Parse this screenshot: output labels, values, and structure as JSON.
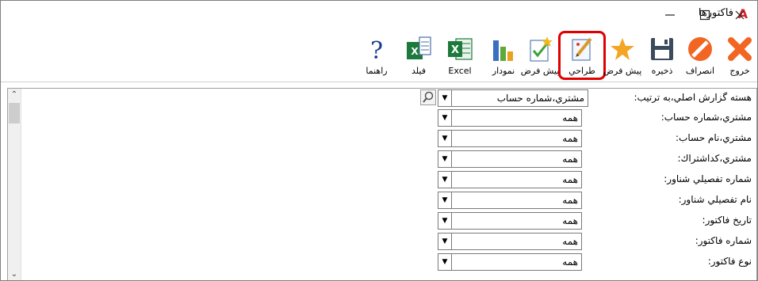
{
  "window": {
    "title": "فاکتورها"
  },
  "toolbar": {
    "help": "راهنما",
    "field": "فیلد",
    "excel": "Excel",
    "chart": "نمودار",
    "default": "پیش فرض",
    "design": "طراحي",
    "save_default": "پیش فرض",
    "save": "ذخیره",
    "cancel": "انصراف",
    "exit": "خروج"
  },
  "report": {
    "core_label": "هسته گزارش اصلي،به ترتیب:",
    "core_value": "مشتري،شماره حساب"
  },
  "filters": [
    {
      "label": "مشتري،شماره حساب:",
      "value": "همه"
    },
    {
      "label": "مشتري،نام حساب:",
      "value": "همه"
    },
    {
      "label": "مشتري،کداشتراك:",
      "value": "همه"
    },
    {
      "label": "شماره تفصیلي شناور:",
      "value": "همه"
    },
    {
      "label": "نام تفصیلي شناور:",
      "value": "همه"
    },
    {
      "label": "تاریخ فاکتور:",
      "value": "همه"
    },
    {
      "label": "شماره فاکتور:",
      "value": "همه"
    },
    {
      "label": "نوع فاکتور:",
      "value": "همه"
    }
  ]
}
